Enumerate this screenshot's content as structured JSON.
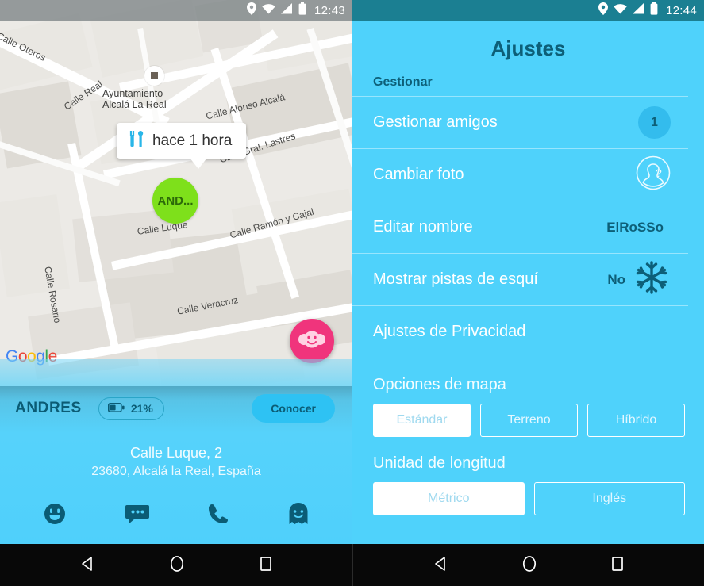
{
  "left": {
    "statusbar": {
      "time": "12:43",
      "icons": [
        "location-pin-icon",
        "wifi-icon",
        "signal-icon",
        "battery-icon"
      ]
    },
    "map": {
      "provider_watermark": "Google",
      "street_labels": [
        "Calle Oteros",
        "Calle Real",
        "Calle Alonso Alcalá",
        "Calle Gral. Lastres",
        "Calle Ramón y Cajal",
        "Calle Luque",
        "Calle Rosario",
        "Calle Veracruz"
      ],
      "poi": {
        "line1": "Ayuntamiento",
        "line2": "Alcalá La Real"
      },
      "callout": {
        "icon": "tools-icon",
        "text": "hace 1 hora"
      },
      "marker": {
        "label": "AND...",
        "color": "#7ee01b"
      },
      "fab": {
        "icon": "friends-icon",
        "color": "#f0347c"
      }
    },
    "info": {
      "user_name": "ANDRES",
      "battery": "21%",
      "battery_icon": "battery-icon",
      "action_label": "Conocer",
      "address_line1": "Calle Luque, 2",
      "address_line2": "23680, Alcalá la Real, España"
    },
    "toolbar": {
      "items": [
        {
          "name": "smiley-icon"
        },
        {
          "name": "chat-icon"
        },
        {
          "name": "phone-icon"
        },
        {
          "name": "ghost-icon"
        }
      ]
    },
    "navbar": {
      "back": "back-icon",
      "home": "home-icon",
      "recents": "recents-icon"
    }
  },
  "right": {
    "statusbar": {
      "time": "12:44",
      "icons": [
        "location-pin-icon",
        "wifi-icon",
        "signal-icon",
        "battery-icon"
      ],
      "background": "#1b7f92"
    },
    "title": "Ajustes",
    "section_label": "Gestionar",
    "rows": [
      {
        "label": "Gestionar amigos",
        "badge": "1",
        "accessory": "badge"
      },
      {
        "label": "Cambiar foto",
        "accessory": "avatar-question-icon"
      },
      {
        "label": "Editar nombre",
        "value": "ElRoSSo",
        "accessory": "value"
      },
      {
        "label": "Mostrar pistas de esquí",
        "value": "No",
        "accessory": "snowflake-icon"
      },
      {
        "label": "Ajustes de Privacidad",
        "accessory": "none"
      }
    ],
    "map_options": {
      "title": "Opciones de mapa",
      "options": [
        "Estándar",
        "Terreno",
        "Híbrido"
      ],
      "selected": "Estándar"
    },
    "length_unit": {
      "title": "Unidad de longitud",
      "options": [
        "Métrico",
        "Inglés"
      ],
      "selected": "Métrico"
    },
    "navbar": {
      "back": "back-icon",
      "home": "home-icon",
      "recents": "recents-icon"
    }
  },
  "theme": {
    "accent_cyan": "#4fd2fb",
    "dark_teal": "#0d5f78",
    "status_teal": "#1b7f92",
    "marker_green": "#7ee01b",
    "fab_pink": "#f0347c"
  }
}
